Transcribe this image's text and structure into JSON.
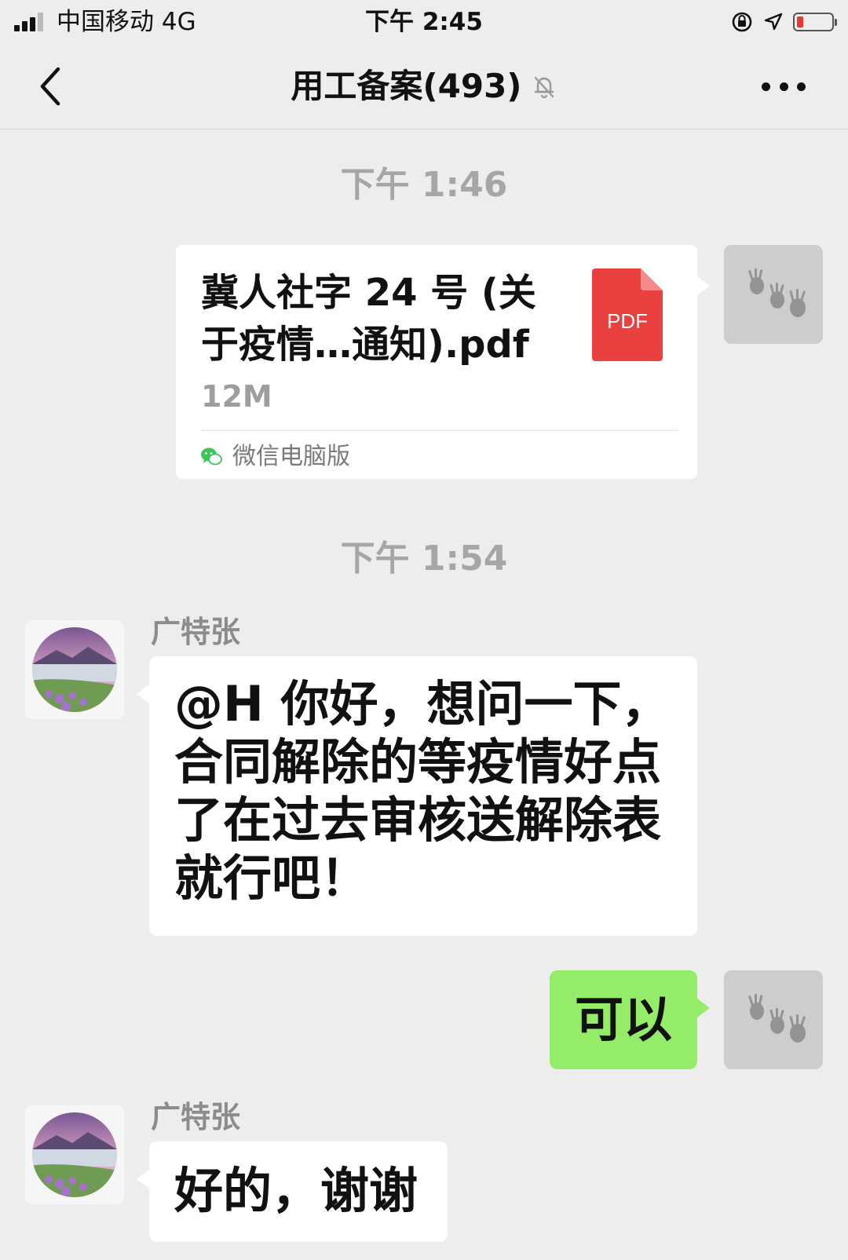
{
  "status_bar": {
    "carrier": "中国移动  4G",
    "time": "下午 2:45",
    "icons": [
      "signal-icon",
      "rotation-lock-icon",
      "location-icon",
      "battery-icon"
    ],
    "battery_color": "#e53935"
  },
  "nav": {
    "back_icon": "chevron-left-icon",
    "title": "用工备案(493)",
    "mute_icon": "bell-muted-icon",
    "more_icon": "more-dots-icon"
  },
  "messages": {
    "time1": "下午 1:46",
    "file": {
      "name": "冀人社字 24 号 (关于疫情…通知).pdf",
      "size": "12M",
      "icon_label": "PDF",
      "icon_color": "#e8413f",
      "source": "微信电脑版",
      "source_icon": "wechat-icon"
    },
    "time2": "下午 1:54",
    "msg1": {
      "sender": "广特张",
      "text": "@H 你好，想问一下，合同解除的等疫情好点了在过去审核送解除表就行吧！"
    },
    "msg2": {
      "text": "可以"
    },
    "msg3": {
      "sender": "广特张",
      "text": "好的，谢谢"
    }
  },
  "colors": {
    "background": "#ededed",
    "outgoing_bubble": "#95ec69",
    "incoming_bubble": "#ffffff"
  }
}
